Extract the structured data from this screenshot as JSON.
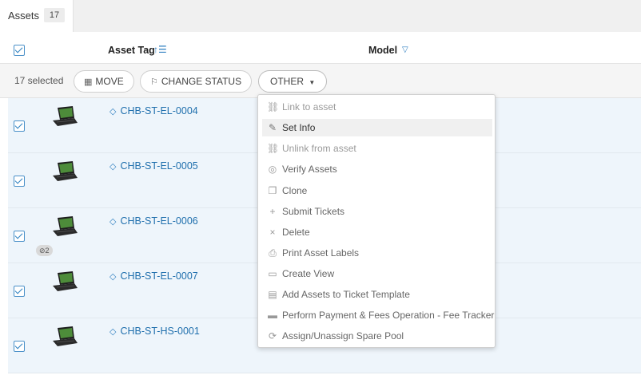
{
  "tab": {
    "label": "Assets",
    "count": "17"
  },
  "header": {
    "asset_tag": "Asset Tag",
    "model": "Model"
  },
  "actionbar": {
    "selected": "17 selected",
    "move": "MOVE",
    "change_status": "CHANGE STATUS",
    "other": "OTHER"
  },
  "rows": [
    {
      "tag": "CHB-ST-EL-0004"
    },
    {
      "tag": "CHB-ST-EL-0005"
    },
    {
      "tag": "CHB-ST-EL-0006",
      "chip": "2"
    },
    {
      "tag": "CHB-ST-EL-0007"
    },
    {
      "tag": "CHB-ST-HS-0001"
    }
  ],
  "menu": {
    "items": [
      {
        "label": "Link to asset",
        "icon": "link-icon"
      },
      {
        "label": "Set Info",
        "icon": "pencil-icon"
      },
      {
        "label": "Unlink from asset",
        "icon": "unlink-icon"
      },
      {
        "label": "Verify Assets",
        "icon": "fingerprint-icon"
      },
      {
        "label": "Clone",
        "icon": "clone-icon"
      },
      {
        "label": "Submit Tickets",
        "icon": "plus-icon"
      },
      {
        "label": "Delete",
        "icon": "close-icon"
      },
      {
        "label": "Print Asset Labels",
        "icon": "printer-icon"
      },
      {
        "label": "Create View",
        "icon": "window-icon"
      },
      {
        "label": "Add Assets to Ticket Template",
        "icon": "clipboard-icon"
      },
      {
        "label": "Perform Payment & Fees Operation - Fee Tracker",
        "icon": "credit-card-icon"
      },
      {
        "label": "Assign/Unassign Spare Pool",
        "icon": "refresh-icon"
      }
    ]
  },
  "colors": {
    "accent": "#2f7fc1",
    "row_selected_bg": "#eef5fb"
  }
}
